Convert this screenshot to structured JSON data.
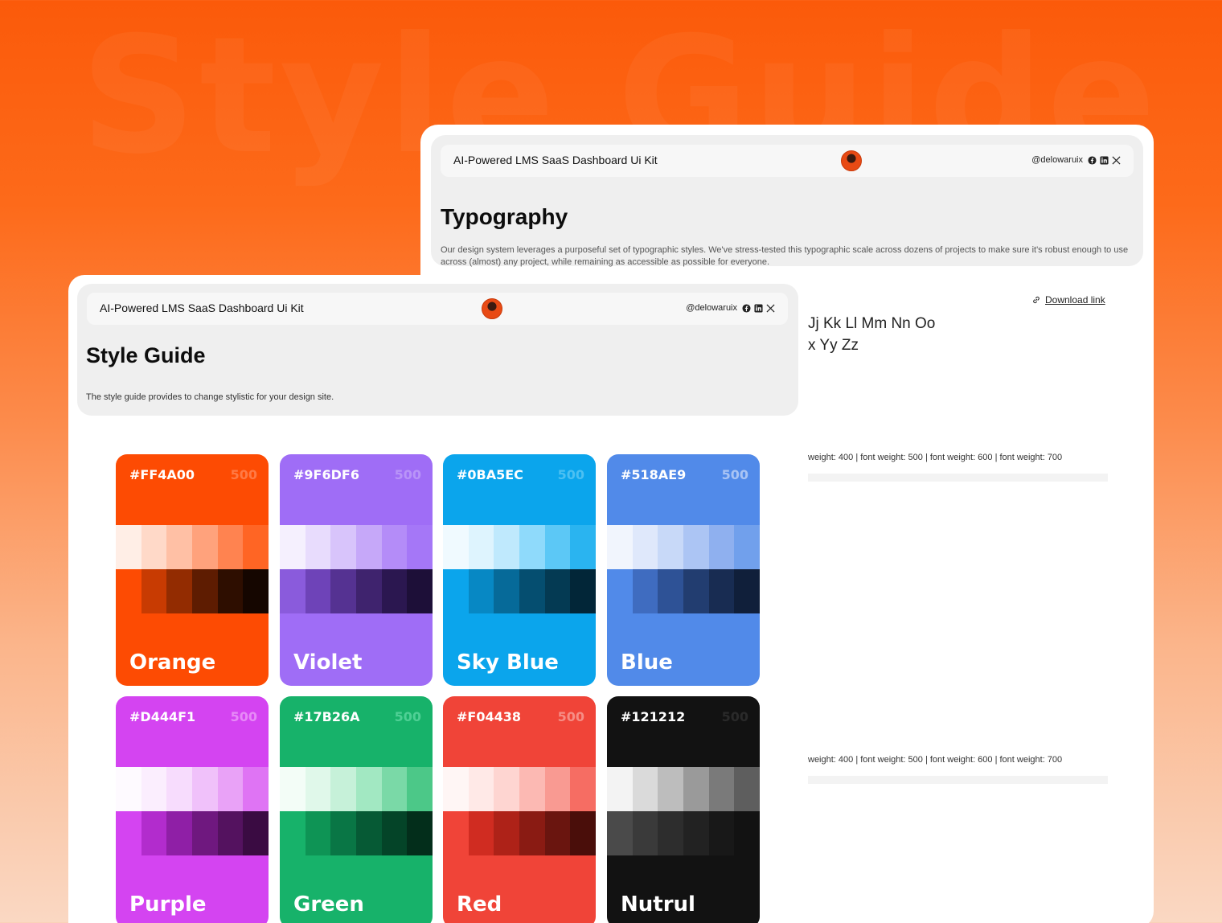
{
  "background_title": "Style Guide",
  "typography_page": {
    "kit_title": "AI-Powered LMS SaaS Dashboard Ui Kit",
    "handle": "@delowaruix",
    "heading": "Typography",
    "description": "Our design system leverages a purposeful set of typographic styles. We've stress-tested this typographic scale across dozens of projects to make sure it's robust enough to use across (almost) any project, while remaining as accessible as possible for everyone.",
    "download_label": "Download link",
    "alphabet_line1": "Jj Kk Ll Mm Nn Oo",
    "alphabet_line2": "x Yy Zz",
    "weights_line1": "weight: 400  |  font weight: 500  |  font weight: 600  |  font weight: 700",
    "weights_line2": "weight: 400  |  font weight: 500  |  font weight: 600  |  font weight: 700"
  },
  "style_guide_page": {
    "kit_title": "AI-Powered LMS SaaS Dashboard Ui Kit",
    "handle": "@delowaruix",
    "heading": "Style Guide",
    "description": "The style guide provides to change stylistic for your design site."
  },
  "social_icons": [
    "facebook-icon",
    "linkedin-icon",
    "x-icon"
  ],
  "swatches": [
    {
      "hex": "#FF4A00",
      "level": "500",
      "name": "Orange",
      "base": "#fd4b03",
      "level_color": "#ff7a45",
      "light": [
        "#ffeee6",
        "#ffd9c8",
        "#ffc0a5",
        "#ffa27c",
        "#ff8350",
        "#ff6524"
      ],
      "dark": [
        "#fd4b03",
        "#c83b02",
        "#932c01",
        "#5e1c01",
        "#2e0e00",
        "#150600"
      ]
    },
    {
      "hex": "#9F6DF6",
      "level": "500",
      "name": "Violet",
      "base": "#9f6df6",
      "level_color": "#b994f8",
      "light": [
        "#f5f0fe",
        "#e8dcfd",
        "#d8c4fb",
        "#c6a8f9",
        "#b48cf8",
        "#a577f7"
      ],
      "dark": [
        "#8a5bdc",
        "#6e43b8",
        "#553292",
        "#3f236e",
        "#2b1750",
        "#1d0f38"
      ]
    },
    {
      "hex": "#0BA5EC",
      "level": "500",
      "name": "Sky Blue",
      "base": "#0ba5ec",
      "level_color": "#4cc0f2",
      "light": [
        "#f0faff",
        "#def4fe",
        "#bfe9fd",
        "#8fdafb",
        "#5cc8f6",
        "#2ab4f0"
      ],
      "dark": [
        "#0ba5ec",
        "#0788c4",
        "#066a99",
        "#054e70",
        "#043a53",
        "#022638"
      ]
    },
    {
      "hex": "#518AE9",
      "level": "500",
      "name": "Blue",
      "base": "#518ae9",
      "level_color": "#a9c4f4",
      "light": [
        "#f1f5fd",
        "#dfe8fb",
        "#c8d9f8",
        "#acc5f4",
        "#8fb0ef",
        "#71a0ec"
      ],
      "dark": [
        "#518ae9",
        "#3f6cc0",
        "#2e5296",
        "#223d70",
        "#182c52",
        "#101f3a"
      ]
    },
    {
      "hex": "#D444F1",
      "level": "500",
      "name": "Purple",
      "base": "#d444f1",
      "level_color": "#e78af7",
      "light": [
        "#fefaff",
        "#fbeefe",
        "#f7dcfd",
        "#f0c1fa",
        "#e9a2f7",
        "#df74f4"
      ],
      "dark": [
        "#d444f1",
        "#b22ccd",
        "#8f1fa6",
        "#6f187f",
        "#54125f",
        "#3a0b42"
      ]
    },
    {
      "hex": "#17B26A",
      "level": "500",
      "name": "Green",
      "base": "#17b26a",
      "level_color": "#4fd095",
      "light": [
        "#f3fdf7",
        "#e0f8ea",
        "#c6f1d9",
        "#a2e8c2",
        "#7ad9a7",
        "#4cc888"
      ],
      "dark": [
        "#17b26a",
        "#0e9455",
        "#097645",
        "#065a35",
        "#044428",
        "#032e1b"
      ]
    },
    {
      "hex": "#F04438",
      "level": "500",
      "name": "Red",
      "base": "#f04438",
      "level_color": "#f68d85",
      "light": [
        "#fff6f5",
        "#ffe9e7",
        "#fed5d1",
        "#fcb9b3",
        "#f99a92",
        "#f66d63"
      ],
      "dark": [
        "#f04438",
        "#d02c21",
        "#ae2218",
        "#8a1b13",
        "#6a150f",
        "#4a0e0a"
      ]
    },
    {
      "hex": "#121212",
      "level": "500",
      "name": "Nutrul",
      "base": "#121212",
      "level_color": "#2a2a2a",
      "light": [
        "#f3f3f3",
        "#dadada",
        "#bdbdbd",
        "#9a9a9a",
        "#7a7a7a",
        "#5e5e5e"
      ],
      "dark": [
        "#4a4a4a",
        "#3a3a3a",
        "#2d2d2d",
        "#222222",
        "#181818",
        "#121212"
      ]
    }
  ]
}
